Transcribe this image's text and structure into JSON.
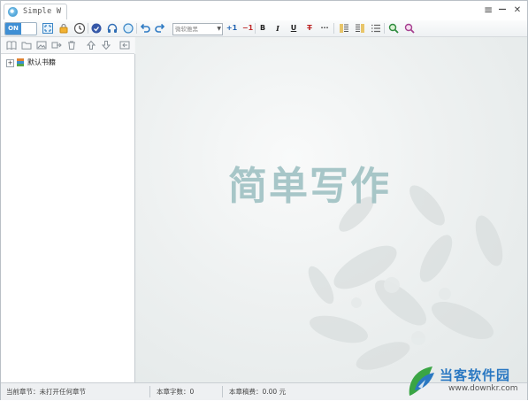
{
  "titlebar": {
    "tab_title": "Simple W",
    "tab_close": "×",
    "menu": "≡",
    "minimize": "—",
    "close": "✕"
  },
  "toolbar": {
    "toggle_on": "ON",
    "search_placeholder": "微软雅黑",
    "font_size_up": "+1",
    "font_size_down": "−1",
    "bold": "B",
    "italic": "I",
    "underline": "U",
    "strikethrough": "T",
    "more": "···"
  },
  "sidebar": {
    "tree": [
      {
        "label": "默认书籍",
        "expander": "+"
      }
    ]
  },
  "editor": {
    "watermark": "简单写作"
  },
  "statusbar": {
    "current_chapter": "当前章节：未打开任何章节",
    "word_count": "本章字数：0",
    "fee": "本章稿费：0.00 元"
  },
  "corner_logo": {
    "brand": "当客软件园",
    "url": "www.downkr.com"
  },
  "colors": {
    "accent": "#3f8fd4",
    "watermark": "#9fc1c3",
    "brand": "#2a78c2"
  }
}
